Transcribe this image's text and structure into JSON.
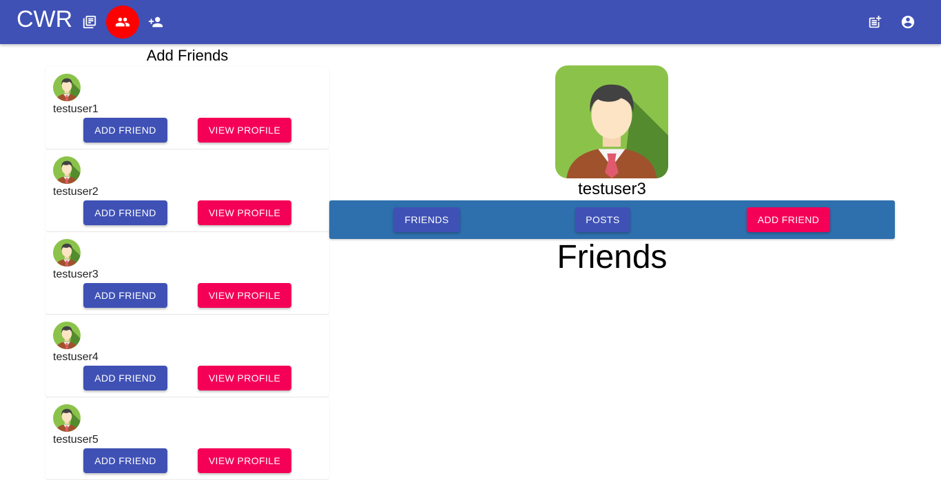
{
  "appbar": {
    "brand": "CWR",
    "icons": [
      "library-icon",
      "people-icon",
      "add-people-icon",
      "post-add-icon",
      "account-circle-icon"
    ]
  },
  "add_friends": {
    "title": "Add Friends",
    "users": [
      {
        "username": "testuser1",
        "add_label": "ADD FRIEND",
        "view_label": "VIEW PROFILE"
      },
      {
        "username": "testuser2",
        "add_label": "ADD FRIEND",
        "view_label": "VIEW PROFILE"
      },
      {
        "username": "testuser3",
        "add_label": "ADD FRIEND",
        "view_label": "VIEW PROFILE"
      },
      {
        "username": "testuser4",
        "add_label": "ADD FRIEND",
        "view_label": "VIEW PROFILE"
      },
      {
        "username": "testuser5",
        "add_label": "ADD FRIEND",
        "view_label": "VIEW PROFILE"
      }
    ]
  },
  "profile": {
    "username": "testuser3",
    "tabs": {
      "friends": "FRIENDS",
      "posts": "POSTS",
      "add_friend": "ADD FRIEND"
    },
    "section_title": "Friends"
  },
  "colors": {
    "appbar": "#3f51b5",
    "active_icon_bg": "#ff0000",
    "primary_button": "#3f51b5",
    "secondary_button": "#f50057",
    "tab_bar": "#2e6fad"
  }
}
